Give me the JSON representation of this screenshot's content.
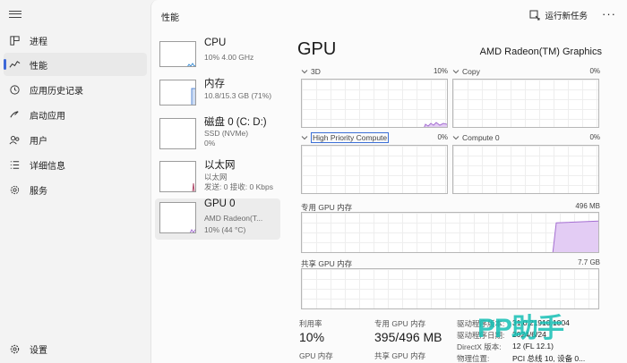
{
  "nav": {
    "items": [
      {
        "label": "进程",
        "icon": "processes-icon"
      },
      {
        "label": "性能",
        "icon": "performance-icon",
        "active": true
      },
      {
        "label": "应用历史记录",
        "icon": "app-history-icon"
      },
      {
        "label": "启动应用",
        "icon": "startup-apps-icon"
      },
      {
        "label": "用户",
        "icon": "users-icon"
      },
      {
        "label": "详细信息",
        "icon": "details-icon"
      },
      {
        "label": "服务",
        "icon": "services-icon"
      }
    ],
    "settings_label": "设置"
  },
  "header": {
    "title": "性能",
    "run_task_label": "运行新任务",
    "more_label": "···"
  },
  "devices": [
    {
      "name": "CPU",
      "sub1": "10%  4.00 GHz",
      "sub2": "",
      "sub3": ""
    },
    {
      "name": "内存",
      "sub1": "10.8/15.3 GB (71%)",
      "sub2": "",
      "sub3": ""
    },
    {
      "name": "磁盘 0 (C: D:)",
      "sub1": "SSD (NVMe)",
      "sub2": "0%",
      "sub3": ""
    },
    {
      "name": "以太网",
      "sub1": "以太网",
      "sub2": "发送: 0 接收: 0 Kbps",
      "sub3": ""
    },
    {
      "name": "GPU 0",
      "sub1": "AMD Radeon(T...",
      "sub2": "10% (44 °C)",
      "sub3": "",
      "selected": true
    }
  ],
  "detail": {
    "title": "GPU",
    "model": "AMD Radeon(TM) Graphics",
    "engines": [
      {
        "label": "3D",
        "pct": "10%"
      },
      {
        "label": "Copy",
        "pct": "0%"
      },
      {
        "label": "High Priority Compute",
        "pct": "0%"
      },
      {
        "label": "Compute 0",
        "pct": "0%"
      }
    ],
    "dedicated_label": "专用 GPU 内存",
    "dedicated_max": "496 MB",
    "shared_label": "共享 GPU 内存",
    "shared_max": "7.7 GB",
    "stats": {
      "util_label": "利用率",
      "util_value": "10%",
      "ded_label": "专用 GPU 内存",
      "ded_value": "395/496 MB",
      "gpu_mem_label": "GPU 内存",
      "shared_label": "共享 GPU 内存"
    },
    "info": [
      {
        "k": "驱动程序版本:",
        "v": "31.0.21910.1004"
      },
      {
        "k": "驱动程序日期:",
        "v": "2024/6/24"
      },
      {
        "k": "DirectX 版本:",
        "v": "12 (FL 12.1)"
      },
      {
        "k": "物理位置:",
        "v": "PCI 总线 10, 设备 0..."
      }
    ],
    "usage": {
      "util_fraction": 0.1,
      "dedicated_fraction": 0.8
    }
  },
  "watermark": "PP助手",
  "colors": {
    "accent": "#3d68d8",
    "gpu_line": "#a46fd1",
    "gpu_fill": "#e3ccf4",
    "mem_line": "#5b8bd6",
    "net_line": "#b04a6a"
  }
}
